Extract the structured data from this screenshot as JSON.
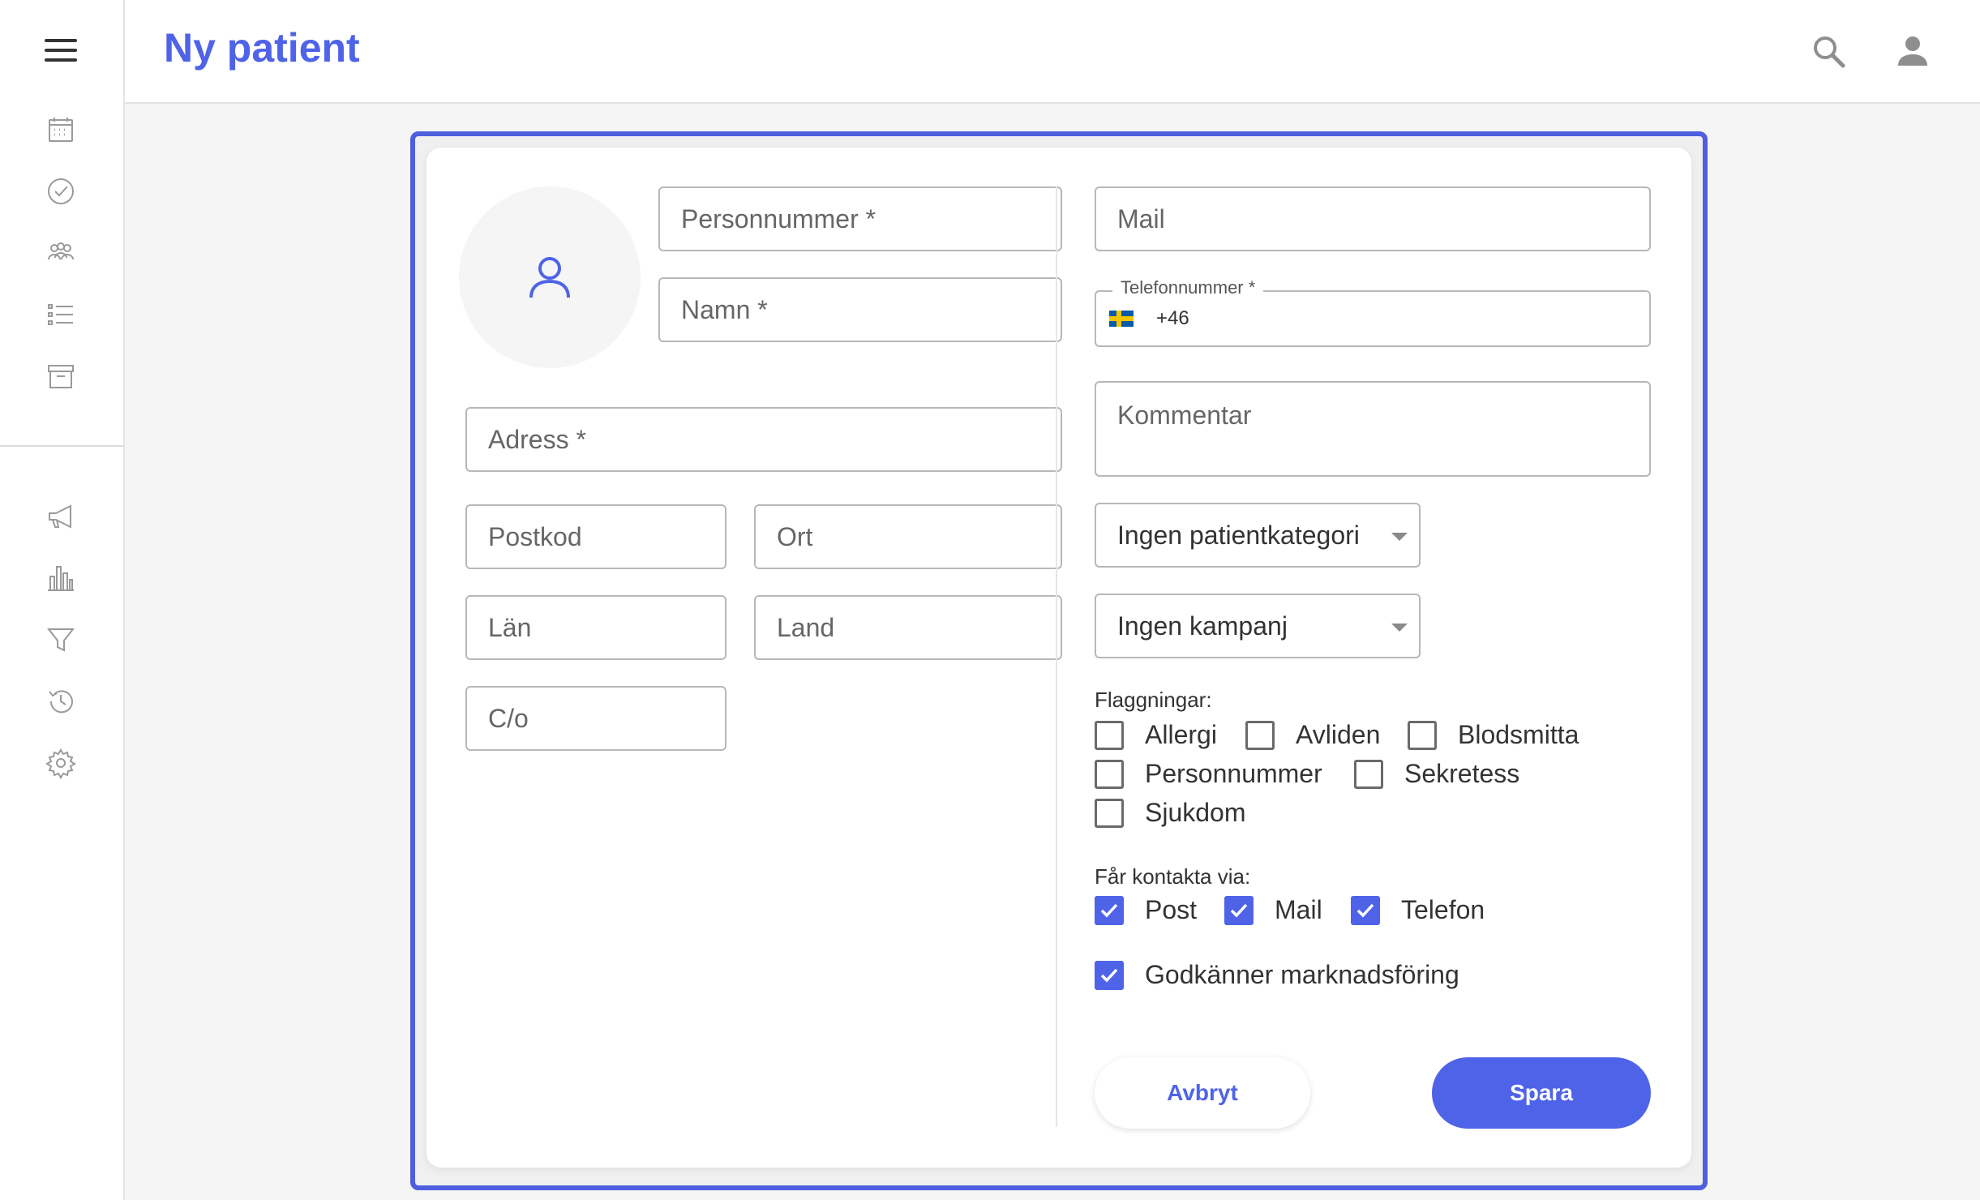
{
  "header": {
    "title": "Ny patient"
  },
  "sidebar": {
    "icons": [
      "menu-icon",
      "calendar-icon",
      "check-circle-icon",
      "people-icon",
      "list-icon",
      "archive-icon",
      "megaphone-icon",
      "bar-chart-icon",
      "filter-icon",
      "history-icon",
      "settings-icon"
    ]
  },
  "form": {
    "personnummer_placeholder": "Personnummer *",
    "namn_placeholder": "Namn *",
    "adress_placeholder": "Adress *",
    "postkod_placeholder": "Postkod",
    "ort_placeholder": "Ort",
    "lan_placeholder": "Län",
    "land_placeholder": "Land",
    "co_placeholder": "C/o",
    "mail_placeholder": "Mail",
    "telefon_label": "Telefonnummer *",
    "telefon_prefix": "+46",
    "kommentar_placeholder": "Kommentar",
    "patientkategori_value": "Ingen patientkategori",
    "kampanj_value": "Ingen kampanj"
  },
  "flags": {
    "label": "Flaggningar:",
    "items": [
      {
        "label": "Allergi",
        "checked": false
      },
      {
        "label": "Avliden",
        "checked": false
      },
      {
        "label": "Blodsmitta",
        "checked": false
      },
      {
        "label": "Personnummer",
        "checked": false
      },
      {
        "label": "Sekretess",
        "checked": false
      },
      {
        "label": "Sjukdom",
        "checked": false
      }
    ]
  },
  "contact": {
    "label": "Får kontakta via:",
    "items": [
      {
        "label": "Post",
        "checked": true
      },
      {
        "label": "Mail",
        "checked": true
      },
      {
        "label": "Telefon",
        "checked": true
      }
    ]
  },
  "marketing": {
    "label": "Godkänner marknadsföring",
    "checked": true
  },
  "buttons": {
    "cancel": "Avbryt",
    "save": "Spara"
  },
  "colors": {
    "accent": "#4f63e8"
  }
}
